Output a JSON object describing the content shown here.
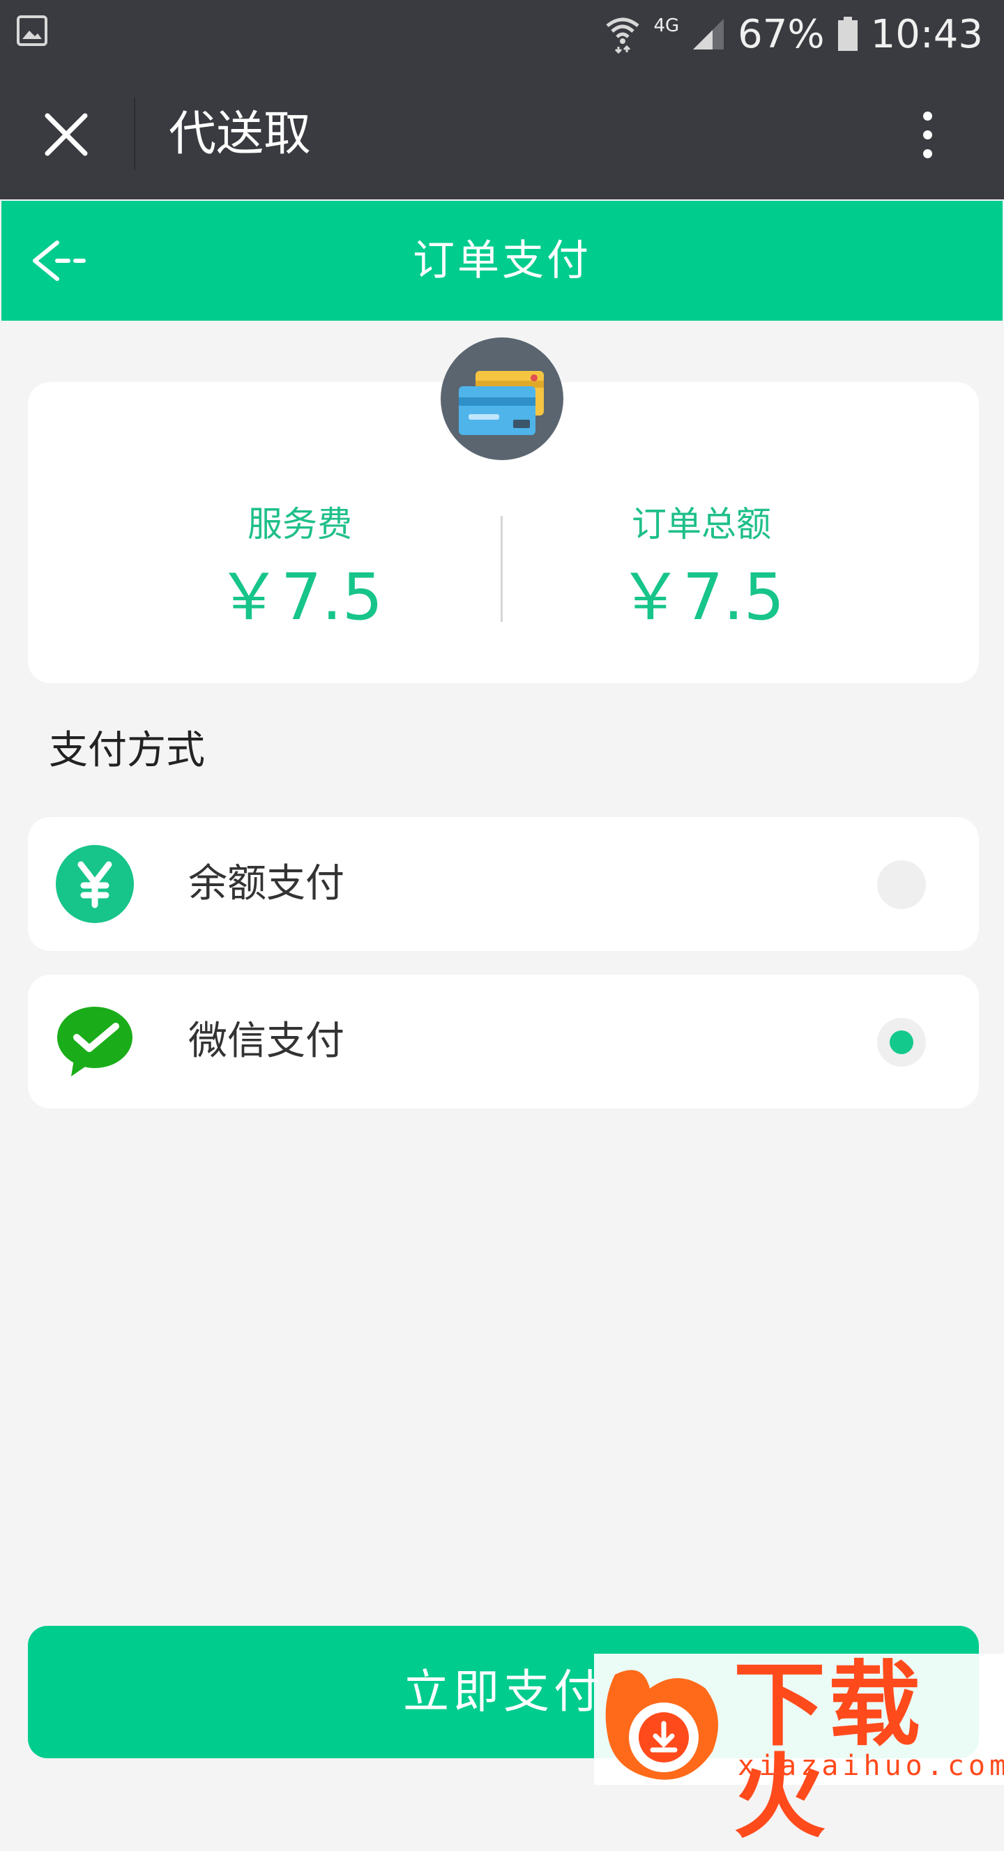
{
  "status_bar": {
    "network": "4G",
    "battery": "67%",
    "time": "10:43"
  },
  "header": {
    "title": "代送取",
    "close_icon": "close-icon",
    "more_icon": "more-vertical-icon"
  },
  "nav": {
    "title": "订单支付",
    "back_icon": "back-arrow-icon"
  },
  "summary": {
    "icon": "credit-card-icon",
    "service_fee_label": "服务费",
    "service_fee_value": "￥7.5",
    "order_total_label": "订单总额",
    "order_total_value": "￥7.5"
  },
  "payment": {
    "section_label": "支付方式",
    "methods": [
      {
        "label": "余额支付",
        "icon": "yuan-icon",
        "selected": false,
        "icon_color": "#17c489"
      },
      {
        "label": "微信支付",
        "icon": "wechat-pay-icon",
        "selected": true,
        "icon_color": "#1aad19"
      }
    ]
  },
  "pay_button": "立即支付",
  "watermark": {
    "text": "下载火",
    "sub": "xiazaihuo.com"
  },
  "colors": {
    "accent": "#00cc8e",
    "header_bg": "#3a3b40",
    "page_bg": "#f4f4f4"
  }
}
